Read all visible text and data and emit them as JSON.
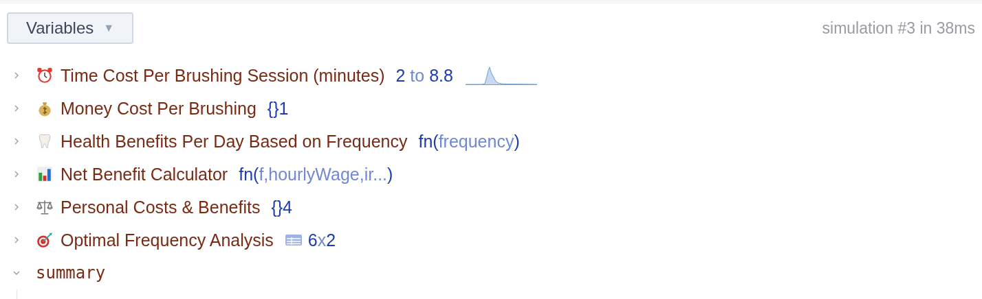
{
  "header": {
    "dropdown": {
      "label": "Variables",
      "caret": "▼"
    },
    "status": "simulation #3 in 38ms"
  },
  "variables": [
    {
      "name": "Time Cost Per Brushing Session (minutes)",
      "expanded": false,
      "monospace": false,
      "value": {
        "kind": "range",
        "low": "2",
        "sep": "to",
        "high": "8.8"
      }
    },
    {
      "name": "Money Cost Per Brushing",
      "expanded": false,
      "monospace": false,
      "value": {
        "kind": "record",
        "braces": "{}",
        "count": "1"
      }
    },
    {
      "name": "Health Benefits Per Day Based on Frequency",
      "expanded": false,
      "monospace": false,
      "value": {
        "kind": "function",
        "open": "fn(",
        "params": "frequency",
        "close": ")"
      }
    },
    {
      "name": "Net Benefit Calculator",
      "expanded": false,
      "monospace": false,
      "value": {
        "kind": "function",
        "open": "fn(",
        "params": "f,hourlyWage,ir...",
        "close": ")"
      }
    },
    {
      "name": "Personal Costs & Benefits",
      "expanded": false,
      "monospace": false,
      "value": {
        "kind": "record",
        "braces": "{}",
        "count": "4"
      }
    },
    {
      "name": "Optimal Frequency Analysis",
      "expanded": false,
      "monospace": false,
      "value": {
        "kind": "table",
        "rows": "6",
        "sep": "x",
        "cols": "2"
      }
    },
    {
      "name": "summary",
      "expanded": true,
      "monospace": true
    }
  ]
}
